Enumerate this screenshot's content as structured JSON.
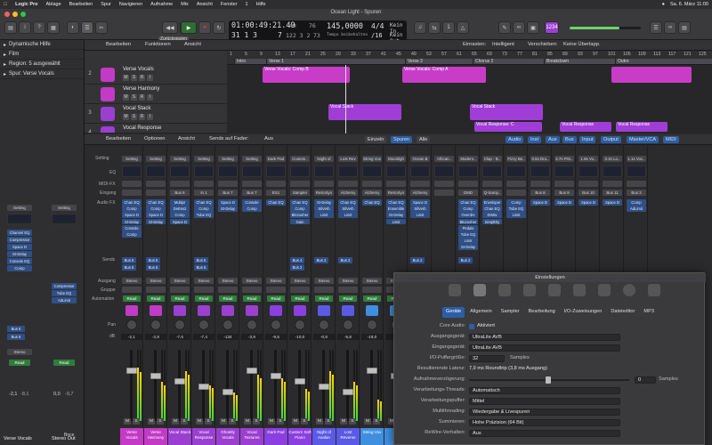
{
  "menubar": {
    "apple": "",
    "app": "Logic Pro",
    "items": [
      "Ablage",
      "Bearbeiten",
      "Spur",
      "Navigieren",
      "Aufnahme",
      "Mix",
      "Ansicht",
      "Fenster",
      "1",
      "Hilfe"
    ],
    "title": "Ocean Light - Spuren",
    "clock": "Sa. 6. März 11:00"
  },
  "toolbar": {
    "zurueck": "Zurückspulen",
    "time": "01:00:49:21.49",
    "bars": "31 1 3",
    "bars2": "7",
    "tempo": "145,0000",
    "tempo_label": "Tempo beibehalten",
    "sig": "4/4",
    "sig2": "/16",
    "input": "Kein In",
    "output": "Kein Out",
    "small1": "49",
    "small2": "122 3 2",
    "small3": "76",
    "small4": "73",
    "badge": "1234"
  },
  "inspector": {
    "rows": [
      {
        "label": "Dynamische Hilfe"
      },
      {
        "label": "Film"
      },
      {
        "label": "Region: 5 ausgewählt"
      },
      {
        "label": "Spur:  Verse Vocals"
      }
    ],
    "setting": "Setting",
    "left_fx": [
      "Channel EQ",
      "Compressor",
      "Space D",
      "St-Delay",
      "Console EQ",
      "Comp"
    ],
    "right_fx": [
      "Compressor",
      "Tube EQ",
      "AdLimit"
    ],
    "bus5": "Bus 5",
    "bus6": "Bus 6",
    "stereo": "Stereo",
    "read": "Read",
    "vol_l": "-2,1",
    "vol_l2": "-8,1",
    "vol_r": "0,0",
    "vol_r2": "-9,7",
    "bnce": "Bnce",
    "name_l": "Verse Vocals",
    "name_r": "Stereo Out"
  },
  "arrange_menu": {
    "bearbeiten": "Bearbeiten",
    "funktionen": "Funktionen",
    "ansicht": "Ansicht",
    "einrasten_label": "Einrasten:",
    "einrasten": "Intelligent",
    "verschieben_label": "Verschieben:",
    "verschieben": "Keine Überlapp."
  },
  "ruler": {
    "numbers": [
      "1",
      "5",
      "9",
      "13",
      "17",
      "21",
      "25",
      "29",
      "33",
      "37",
      "41",
      "45",
      "49",
      "53",
      "57",
      "61",
      "65",
      "69",
      "73",
      "77",
      "81",
      "85",
      "89",
      "93",
      "97",
      "101",
      "105",
      "109",
      "113",
      "117",
      "121",
      "125"
    ],
    "sections": [
      {
        "label": "Intro"
      },
      {
        "label": "Verse 1"
      },
      {
        "label": "Verse 2"
      },
      {
        "label": "Chorus 2"
      },
      {
        "label": "Breakdown"
      },
      {
        "label": "Outro"
      }
    ]
  },
  "tracks": [
    {
      "num": "2",
      "name": "Verse Vocals",
      "color": "#c23ac6"
    },
    {
      "num": "",
      "name": "Verse Harmony",
      "color": "#c23ac6"
    },
    {
      "num": "3",
      "name": "Vocal Stack",
      "color": "#9b3fd1"
    },
    {
      "num": "4",
      "name": "Vocal Response",
      "color": "#9b3fd1"
    }
  ],
  "regions": [
    {
      "text": "Verse Vocals: Comp B",
      "color": "#c83cc8"
    },
    {
      "text": "Verse Vocals: Comp A",
      "color": "#c83cc8"
    },
    {
      "text": "",
      "color": "#c83cc8"
    },
    {
      "text": "Vocal Stack",
      "color": "#a03dd6"
    },
    {
      "text": "Vocal Stack",
      "color": "#a03dd6"
    },
    {
      "text": "Vocal Response: C",
      "color": "#a03dd6"
    },
    {
      "text": "Vocal Response",
      "color": "#a03dd6"
    },
    {
      "text": "Vocal Response",
      "color": "#a03dd6"
    }
  ],
  "mixer_menu": {
    "bearbeiten": "Bearbeiten",
    "optionen": "Optionen",
    "ansicht": "Ansicht",
    "sends": "Sends auf Fader:",
    "aus": "Aus",
    "einzeln": "Einzeln",
    "spuren": "Spuren",
    "alle": "Alle",
    "filters": [
      "Audio",
      "Inst",
      "Aux",
      "Bus",
      "Input",
      "Output",
      "Master/VCA",
      "MIDI"
    ]
  },
  "mixer_labels": {
    "setting": "Setting",
    "eq": "EQ",
    "midi": "MIDI-FX",
    "eingang": "Eingang",
    "fx": "Audio FX",
    "sends": "Sends",
    "ausgang": "Ausgang",
    "gruppe": "Gruppe",
    "automation": "Automation",
    "pan": "Pan",
    "db": "dB"
  },
  "strips": [
    {
      "setting": "Setting",
      "in": "",
      "fx": [
        "Chan EQ",
        "Comp",
        "Space D",
        "St-Delay",
        "Console",
        "Comp"
      ],
      "vol": "-2,1",
      "vol2": "-8,1",
      "name": "Verse Vocals",
      "color": "#c23ac6",
      "send1": "Bus 5",
      "send2": "Bus 6"
    },
    {
      "setting": "Setting",
      "in": "",
      "fx": [
        "Chan EQ",
        "Comp",
        "Space D",
        "St-Delay"
      ],
      "vol": "-2,8",
      "vol2": "",
      "name": "Verse Harmony",
      "color": "#c23ac6",
      "send1": "Bus 5",
      "send2": "Bus 6"
    },
    {
      "setting": "Setting",
      "in": "Bus 6",
      "fx": [
        "Multipr",
        "DeEss2",
        "Comp",
        "Space D"
      ],
      "vol": "-7,6",
      "vol2": "-9,6",
      "name": "Vocal Stack",
      "color": "#9b3fd1",
      "send1": "",
      "send2": ""
    },
    {
      "setting": "Setting",
      "in": "In 1",
      "fx": [
        "Chan EQ",
        "Comp",
        "Tube EQ"
      ],
      "vol": "-7,4",
      "vol2": "",
      "name": "Vocal Response",
      "color": "#9b3fd1",
      "send1": "Bus 5",
      "send2": "Bus 6"
    },
    {
      "setting": "Setting",
      "in": "Bus 7",
      "fx": [
        "Space D",
        "St-Delay"
      ],
      "vol": "-134",
      "vol2": "",
      "name": "Ghostly Vocals",
      "color": "#9b3fd1",
      "send1": "",
      "send2": ""
    },
    {
      "setting": "Setting",
      "in": "Bus 7",
      "fx": [
        "Console",
        "Comp"
      ],
      "vol": "-3,9",
      "vol2": "-10,0",
      "name": "Vocal Textures",
      "color": "#9b3fd1",
      "send1": "",
      "send2": ""
    },
    {
      "setting": "Dark Pad",
      "in": "ES1",
      "fx": [
        "Chan EQ"
      ],
      "vol": "-9,5",
      "vol2": "-8,6",
      "name": "Dark Pad",
      "color": "#8a3fe0",
      "send1": "",
      "send2": ""
    },
    {
      "setting": "Custom..",
      "in": "Sampler",
      "fx": [
        "Chan EQ",
        "Comp",
        "Bitcrusher",
        "Gain"
      ],
      "vol": "-10,0",
      "vol2": "-11,9",
      "name": "Custom Soft Piano",
      "color": "#8a3fe0",
      "send1": "Bus 4",
      "send2": "Bus 2"
    },
    {
      "setting": "Night of",
      "in": "RetroSyn",
      "fx": [
        "St-Delay",
        "SilVerb",
        "Limit"
      ],
      "vol": "-0,8",
      "vol2": "-14,8",
      "name": "Night of Avalon",
      "color": "#5a5ae6",
      "send1": "Bus 2",
      "send2": ""
    },
    {
      "setting": "Lost Rev",
      "in": "Alchemy",
      "fx": [
        "Chan EQ",
        "SilVerb",
        "Limit"
      ],
      "vol": "-5,8",
      "vol2": "-12,8",
      "name": "Lost Reverse",
      "color": "#5a5ae6",
      "send1": "Bus 2",
      "send2": ""
    },
    {
      "setting": "String Vox",
      "in": "Alchemy",
      "fx": [
        "Chan EQ"
      ],
      "vol": "-18,0",
      "vol2": "",
      "name": "String Vox",
      "color": "#3f8fe0",
      "send1": "",
      "send2": ""
    },
    {
      "setting": "Moonligh",
      "in": "RetroSyn",
      "fx": [
        "Chan EQ",
        "Ensemble",
        "St-Delay",
        "Limit"
      ],
      "vol": "",
      "vol2": "",
      "name": "",
      "color": "#3f8fe0",
      "send1": "",
      "send2": ""
    },
    {
      "setting": "Ocean B",
      "in": "Alchemy",
      "fx": [
        "Space D",
        "SilVerb",
        "Limit"
      ],
      "vol": "",
      "vol2": "",
      "name": "",
      "color": "#3f8fe0",
      "send1": "Bus 2",
      "send2": ""
    },
    {
      "setting": "African..",
      "in": "",
      "fx": [],
      "vol": "",
      "vol2": "",
      "name": "",
      "color": "#2fa0c8",
      "send1": "",
      "send2": ""
    },
    {
      "setting": "Modern..",
      "in": "DMD",
      "fx": [
        "Chan EQ",
        "Comp",
        "Overdrv",
        "Bitcrusher",
        "Pedals",
        "Tube EQ",
        "Limit",
        "St-Delay"
      ],
      "vol": "",
      "vol2": "",
      "name": "",
      "color": "#2fa0c8",
      "send1": "Bus 2",
      "send2": ""
    },
    {
      "setting": "Clap - B..",
      "in": "Q-Samp..",
      "fx": [
        "Enveloper",
        "Chan EQ",
        "DrMix",
        "SimplDly"
      ],
      "vol": "",
      "vol2": "",
      "name": "",
      "color": "#2fa0c8",
      "send1": "",
      "send2": ""
    },
    {
      "setting": "Fizzy Be..",
      "in": "",
      "fx": [
        "Comp",
        "Tube EQ",
        "Limit"
      ],
      "vol": "",
      "vol2": "",
      "name": "",
      "color": "#2fa0c8",
      "send1": "",
      "send2": ""
    },
    {
      "setting": "0.6s Dru..",
      "in": "Bus 8",
      "fx": [
        "Space D"
      ],
      "vol": "",
      "vol2": "",
      "name": "",
      "color": "#2fa0c8",
      "send1": "",
      "send2": ""
    },
    {
      "setting": "4.7s Pris..",
      "in": "Bus 9",
      "fx": [
        "Space D"
      ],
      "vol": "",
      "vol2": "",
      "name": "",
      "color": "#2fa0c8",
      "send1": "",
      "send2": ""
    },
    {
      "setting": "1.8s Vo..",
      "in": "Bus 10",
      "fx": [
        "Space D"
      ],
      "vol": "",
      "vol2": "",
      "name": "",
      "color": "#2fa0c8",
      "send1": "",
      "send2": ""
    },
    {
      "setting": "0.2s Lo..",
      "in": "Bus 11",
      "fx": [
        "Space D"
      ],
      "vol": "",
      "vol2": "",
      "name": "",
      "color": "#2fa0c8",
      "send1": "",
      "send2": ""
    },
    {
      "setting": "1.1s Voc..",
      "in": "Bus 3",
      "fx": [
        "Comp",
        "AdLimit"
      ],
      "vol": "",
      "vol2": "",
      "name": "",
      "color": "#2fa0c8",
      "send1": "",
      "send2": ""
    }
  ],
  "common": {
    "stereo": "Stereo",
    "read": "Read",
    "m": "M",
    "s": "S"
  },
  "prefs": {
    "title": "Einstellungen",
    "tabs": [
      "Geräte",
      "Allgemein",
      "Sampler",
      "Bearbeitung",
      "I/O-Zuweisungen",
      "Dateieditor",
      "MP3"
    ],
    "rows": [
      {
        "label": "Core Audio:",
        "value": "Aktiviert"
      },
      {
        "label": "Ausgangsgerät:",
        "value": "UltraLite AVB"
      },
      {
        "label": "Eingangsgerät:",
        "value": "UltraLite AVB"
      },
      {
        "label": "I/O-Puffergröße:",
        "value": "32",
        "unit": "Samples"
      },
      {
        "label": "Resultierende Latenz:",
        "value": "7,9 ms Roundtrip (3,8 ms Ausgang)"
      },
      {
        "label": "Aufnahmeverzögerung:",
        "value": "0",
        "unit": "Samples"
      },
      {
        "label": "Verarbeitungs-Threads:",
        "value": "Automatisch"
      },
      {
        "label": "Verarbeitungspuffer:",
        "value": "Mittel"
      },
      {
        "label": "Multithreading:",
        "value": "Wiedergabe & Livespuren"
      },
      {
        "label": "Summieren:",
        "value": "Hohe Präzision (64 Bit)"
      },
      {
        "label": "ReWire-Verhalten:",
        "value": "Aus"
      }
    ]
  }
}
